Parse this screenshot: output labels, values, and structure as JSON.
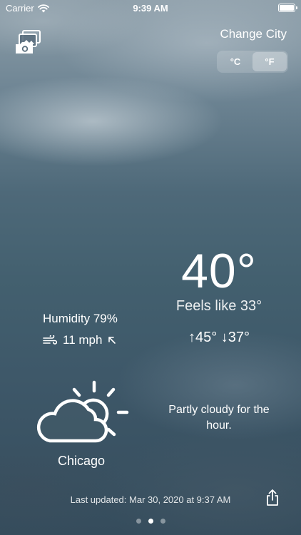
{
  "status_bar": {
    "carrier": "Carrier",
    "time": "9:39 AM",
    "wifi_icon": "wifi-icon",
    "battery_icon": "battery-icon"
  },
  "header": {
    "photo_icon": "photo-library-icon",
    "change_city": "Change City",
    "units": [
      {
        "label": "°C",
        "selected": false
      },
      {
        "label": "°F",
        "selected": true
      }
    ]
  },
  "weather": {
    "temperature": "40°",
    "feels_like": "Feels like 33°",
    "high_low": "↑45° ↓37°",
    "humidity": "Humidity 79%",
    "wind_speed": "11 mph",
    "wind_icon": "wind-icon",
    "wind_direction_icon": "arrow-up-left-icon",
    "condition_icon": "partly-cloudy-icon",
    "city": "Chicago",
    "summary": "Partly cloudy for the hour."
  },
  "footer": {
    "last_updated": "Last updated: Mar 30, 2020 at 9:37 AM",
    "share_icon": "share-icon",
    "page_count": 3,
    "current_page": 2
  },
  "colors": {
    "text": "#ffffff",
    "sky_top": "#8d9ea9",
    "sky_bottom": "#354c5c"
  }
}
